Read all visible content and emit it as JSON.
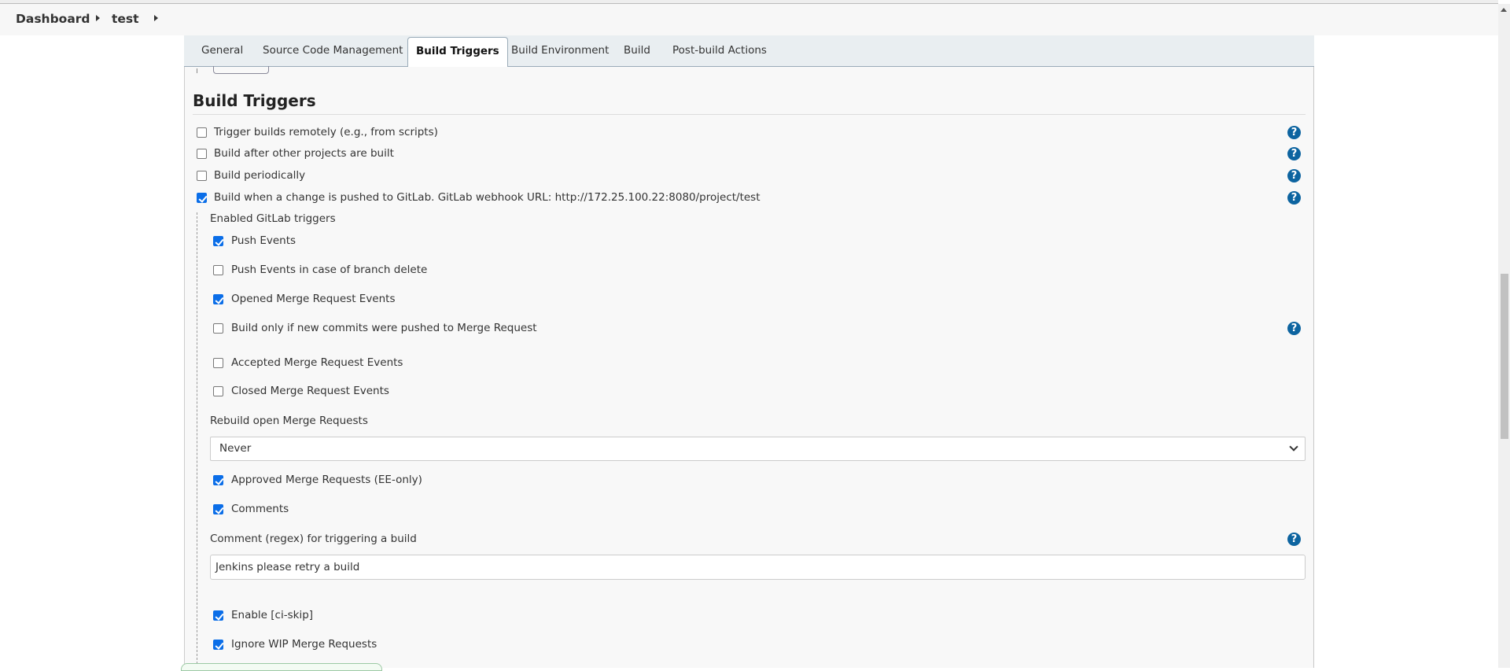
{
  "breadcrumb": [
    "Dashboard",
    "test"
  ],
  "tabs": [
    "General",
    "Source Code Management",
    "Build Triggers",
    "Build Environment",
    "Build",
    "Post-build Actions"
  ],
  "active_tab": "Build Triggers",
  "section_title": "Build Triggers",
  "triggers": [
    {
      "label": "Trigger builds remotely (e.g., from scripts)",
      "checked": false
    },
    {
      "label": "Build after other projects are built",
      "checked": false
    },
    {
      "label": "Build periodically",
      "checked": false
    },
    {
      "label": "Build when a change is pushed to GitLab. GitLab webhook URL: http://172.25.100.22:8080/project/test",
      "checked": true
    }
  ],
  "gitlab": {
    "enabled_label": "Enabled GitLab triggers",
    "options": [
      {
        "label": "Push Events",
        "checked": true
      },
      {
        "label": "Push Events in case of branch delete",
        "checked": false
      },
      {
        "label": "Opened Merge Request Events",
        "checked": true
      },
      {
        "label": "Build only if new commits were pushed to Merge Request",
        "checked": false
      },
      {
        "label": "Accepted Merge Request Events",
        "checked": false
      },
      {
        "label": "Closed Merge Request Events",
        "checked": false
      }
    ],
    "rebuild_label": "Rebuild open Merge Requests",
    "rebuild_value": "Never",
    "options2": [
      {
        "label": "Approved Merge Requests (EE-only)",
        "checked": true
      },
      {
        "label": "Comments",
        "checked": true
      }
    ],
    "comment_label": "Comment (regex) for triggering a build",
    "comment_value": "Jenkins please retry a build",
    "options3": [
      {
        "label": "Enable [ci-skip]",
        "checked": true
      },
      {
        "label": "Ignore WIP Merge Requests",
        "checked": true
      }
    ]
  },
  "help_glyph": "?",
  "colors": {
    "accent": "#0b6ee8",
    "help": "#0d64a0"
  }
}
